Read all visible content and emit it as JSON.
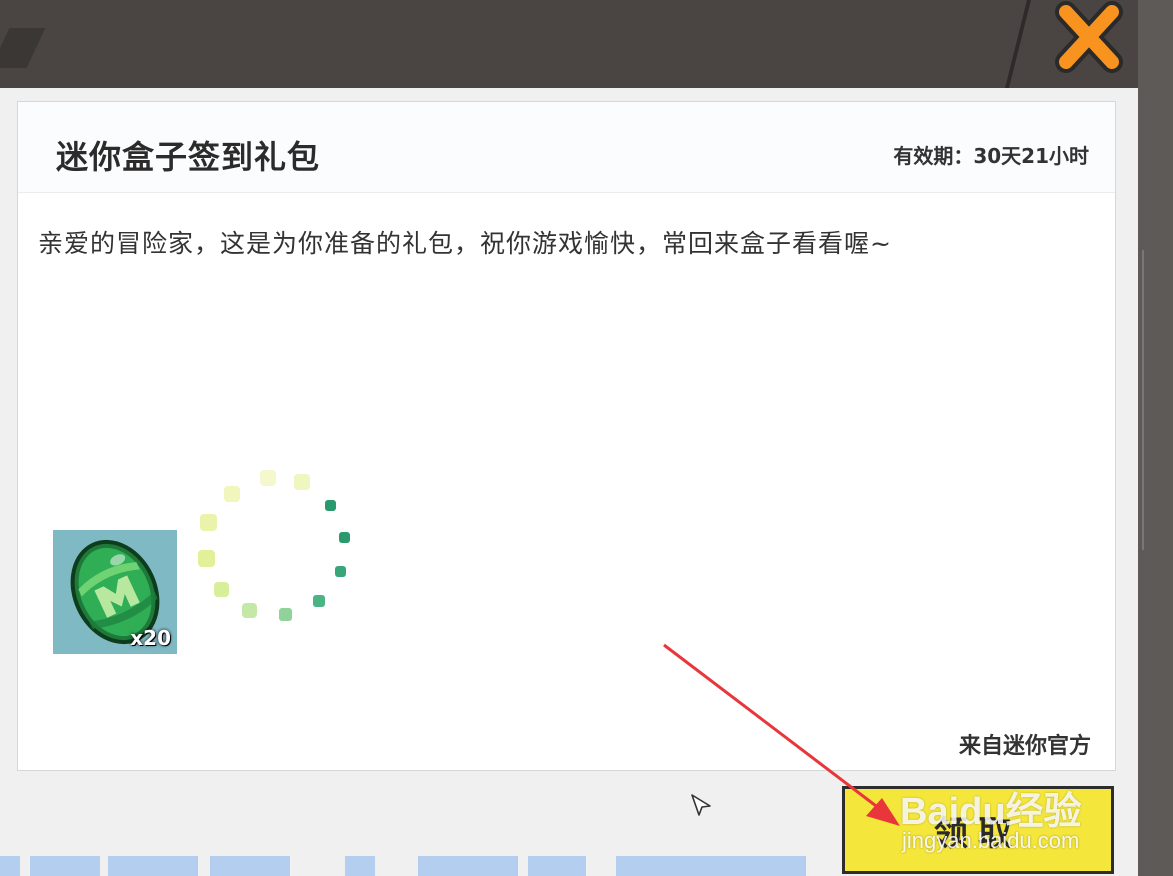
{
  "mail": {
    "title": "迷你盒子签到礼包",
    "expiry": "有效期：30天21小时",
    "message": "亲爱的冒险家，这是为你准备的礼包，祝你游戏愉快，常回来盒子看看喔~",
    "sender": "来自迷你官方"
  },
  "reward": {
    "icon": "green-egg-icon",
    "count": "x20"
  },
  "actions": {
    "claim_label": "领取",
    "close_icon": "close-icon"
  },
  "watermark": {
    "logo": "Baidu经验",
    "url": "jingyan.baidu.com"
  },
  "colors": {
    "topbar": "#4a4543",
    "claim_button": "#f4e63b",
    "close_x": "#f7931e",
    "annotation_arrow": "#e8363a"
  }
}
